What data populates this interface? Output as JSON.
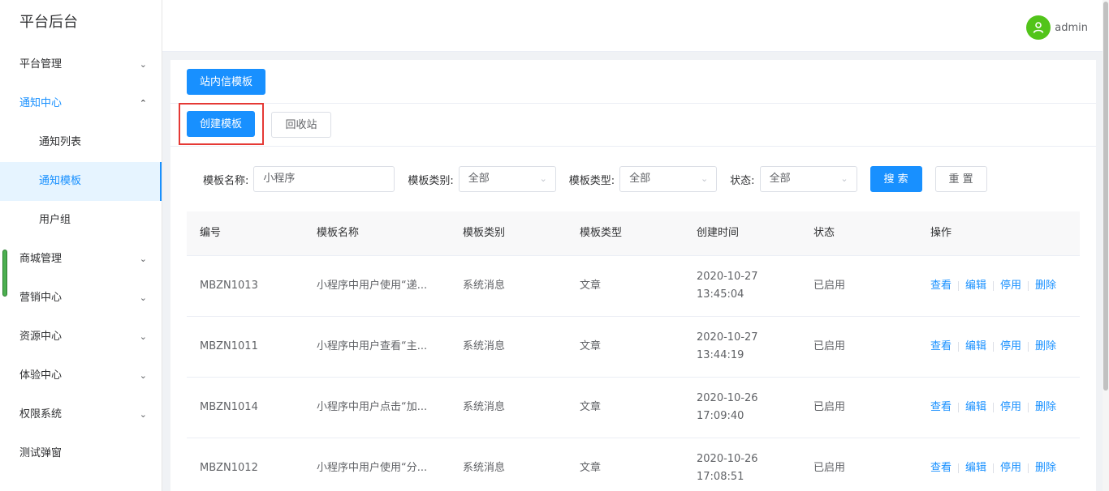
{
  "app": {
    "title": "平台后台"
  },
  "header": {
    "username": "admin"
  },
  "sidebar": {
    "items": [
      {
        "label": "平台管理",
        "chevron": "chevron-down-icon"
      },
      {
        "label": "通知中心",
        "chevron": "chevron-up-icon"
      },
      {
        "label": "商城管理",
        "chevron": "chevron-down-icon"
      },
      {
        "label": "营销中心",
        "chevron": "chevron-down-icon"
      },
      {
        "label": "资源中心",
        "chevron": "chevron-down-icon"
      },
      {
        "label": "体验中心",
        "chevron": "chevron-down-icon"
      },
      {
        "label": "权限系统",
        "chevron": "chevron-down-icon"
      },
      {
        "label": "测试弹窗"
      }
    ],
    "subitems": [
      {
        "label": "通知列表"
      },
      {
        "label": "通知模板"
      },
      {
        "label": "用户组"
      }
    ]
  },
  "toolbar": {
    "tab_label": "站内信模板",
    "create_label": "创建模板",
    "recycle_label": "回收站"
  },
  "filters": {
    "name_label": "模板名称:",
    "name_value": "小程序",
    "category_label": "模板类别:",
    "category_value": "全部",
    "type_label": "模板类型:",
    "type_value": "全部",
    "status_label": "状态:",
    "status_value": "全部",
    "search_label": "搜 索",
    "reset_label": "重 置"
  },
  "table": {
    "headers": [
      "编号",
      "模板名称",
      "模板类别",
      "模板类型",
      "创建时间",
      "状态",
      "操作"
    ],
    "actions": [
      "查看",
      "编辑",
      "停用",
      "删除"
    ],
    "rows": [
      {
        "id": "MBZN1013",
        "name": "小程序中用户使用“递...",
        "category": "系统消息",
        "type": "文章",
        "date": "2020-10-27",
        "time": "13:45:04",
        "status": "已启用"
      },
      {
        "id": "MBZN1011",
        "name": "小程序中用户查看“主...",
        "category": "系统消息",
        "type": "文章",
        "date": "2020-10-27",
        "time": "13:44:19",
        "status": "已启用"
      },
      {
        "id": "MBZN1014",
        "name": "小程序中用户点击“加...",
        "category": "系统消息",
        "type": "文章",
        "date": "2020-10-26",
        "time": "17:09:40",
        "status": "已启用"
      },
      {
        "id": "MBZN1012",
        "name": "小程序中用户使用“分...",
        "category": "系统消息",
        "type": "文章",
        "date": "2020-10-26",
        "time": "17:08:51",
        "status": "已启用"
      }
    ]
  },
  "colors": {
    "primary": "#1890ff",
    "highlight": "#e53935",
    "avatar": "#52c41a"
  }
}
